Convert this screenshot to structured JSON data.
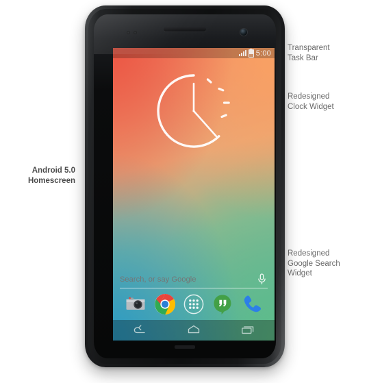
{
  "annotations": {
    "left_title": "Android 5.0\nHomescreen",
    "taskbar": "Transparent\nTask Bar",
    "clock": "Redesigned\nClock Widget",
    "search": "Redesigned\nGoogle Search\nWidget"
  },
  "phone": {
    "device_name": "nexus-phone",
    "earpiece": "earpiece-speaker",
    "front_camera": "front-camera"
  },
  "status_bar": {
    "time": "5:00",
    "signal_icon": "signal-bars-icon",
    "battery_icon": "battery-icon"
  },
  "clock_widget": {
    "name": "analog-clock-widget",
    "hour_hand": "12",
    "minute_hand": "4:30",
    "dash_count": 4,
    "stroke_color": "#ffffff"
  },
  "search_widget": {
    "placeholder": "Search, or say Google",
    "value": "Search, or say Google",
    "mic_icon": "microphone-icon"
  },
  "dock": {
    "items": [
      {
        "name": "camera-app-icon",
        "label": "Camera"
      },
      {
        "name": "chrome-app-icon",
        "label": "Chrome"
      },
      {
        "name": "app-drawer-icon",
        "label": "Apps"
      },
      {
        "name": "hangouts-app-icon",
        "label": "Hangouts"
      },
      {
        "name": "phone-app-icon",
        "label": "Phone"
      }
    ]
  },
  "nav_bar": {
    "items": [
      {
        "name": "back-nav-icon",
        "label": "Back"
      },
      {
        "name": "home-nav-icon",
        "label": "Home"
      },
      {
        "name": "recents-nav-icon",
        "label": "Recents"
      }
    ]
  },
  "colors": {
    "wallpaper_top_left": "#ec5644",
    "wallpaper_top_right": "#faa263",
    "wallpaper_bottom_left": "#2c9ac4",
    "wallpaper_bottom_right": "#60be88",
    "annotation_text": "#6a6a6a",
    "title_text": "#4c4c4c",
    "page_background": "#ffffff"
  }
}
